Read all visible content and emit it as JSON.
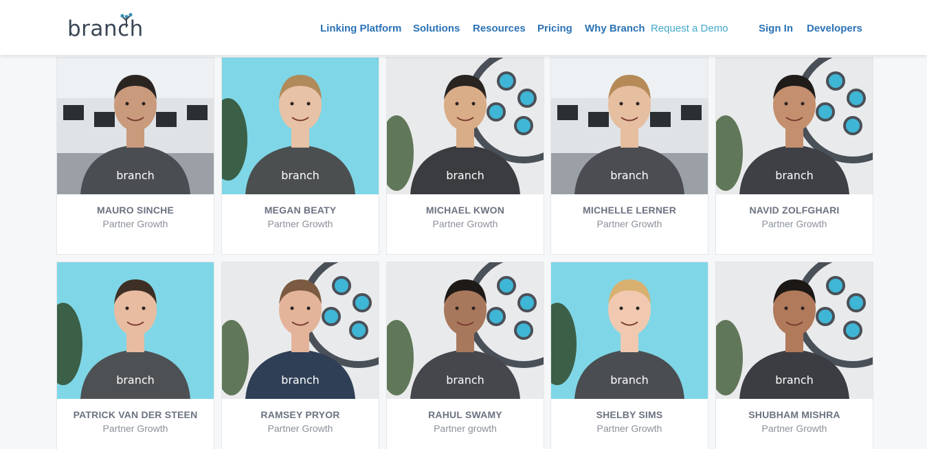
{
  "header": {
    "logo_text": "branch",
    "nav": [
      {
        "label": "Linking Platform"
      },
      {
        "label": "Solutions"
      },
      {
        "label": "Resources"
      },
      {
        "label": "Pricing"
      },
      {
        "label": "Why Branch"
      },
      {
        "label": "Request a Demo"
      },
      {
        "label": "Sign In"
      },
      {
        "label": "Developers"
      }
    ]
  },
  "team": [
    {
      "name": "MAURO SINCHE",
      "role": "Partner Growth",
      "shirt_text": "branch",
      "bg": "office"
    },
    {
      "name": "MEGAN BEATY",
      "role": "Partner Growth",
      "shirt_text": "branch",
      "bg": "cyan"
    },
    {
      "name": "MICHAEL KWON",
      "role": "Partner Growth",
      "shirt_text": "branch",
      "bg": "logo"
    },
    {
      "name": "MICHELLE LERNER",
      "role": "Partner Growth",
      "shirt_text": "branch",
      "bg": "office"
    },
    {
      "name": "NAVID ZOLFGHARI",
      "role": "Partner Growth",
      "shirt_text": "branch",
      "bg": "logo"
    },
    {
      "name": "PATRICK VAN DER STEEN",
      "role": "Partner Growth",
      "shirt_text": "branch",
      "bg": "cyan"
    },
    {
      "name": "RAMSEY PRYOR",
      "role": "Partner Growth",
      "shirt_text": "branch",
      "bg": "logo"
    },
    {
      "name": "RAHUL SWAMY",
      "role": "Partner growth",
      "shirt_text": "branch",
      "bg": "logo"
    },
    {
      "name": "SHELBY SIMS",
      "role": "Partner Growth",
      "shirt_text": "branch",
      "bg": "cyan"
    },
    {
      "name": "SHUBHAM MISHRA",
      "role": "Partner Growth",
      "shirt_text": "branch",
      "bg": "logo"
    }
  ],
  "colors": {
    "nav_link": "#2a72b5",
    "nav_demo": "#3fa7c9",
    "name_text": "#6b7280",
    "role_text": "#8a9099",
    "photo_cyan": "#7fd6e6",
    "shirt": "#4a4d52"
  }
}
